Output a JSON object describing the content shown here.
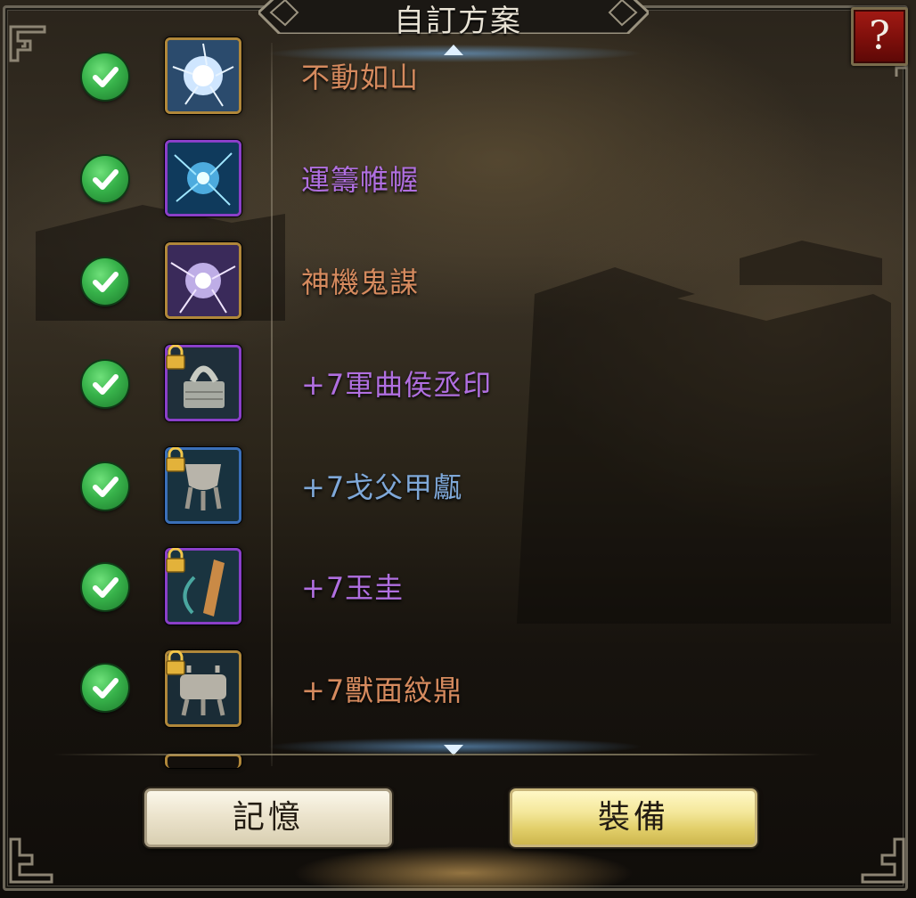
{
  "window": {
    "title": "自訂方案",
    "help_label": "?"
  },
  "list": {
    "items": [
      {
        "name": "不動如山",
        "color": "#d58a5e",
        "checked": true,
        "locked": false,
        "icon": "lightning-orb-icon",
        "frame": "#b0873a"
      },
      {
        "name": "運籌帷幄",
        "color": "#b06fe0",
        "checked": true,
        "locked": false,
        "icon": "blue-burst-icon",
        "frame": "#8a3fc8"
      },
      {
        "name": "神機鬼謀",
        "color": "#d58a5e",
        "checked": true,
        "locked": false,
        "icon": "violet-burst-icon",
        "frame": "#b0873a"
      },
      {
        "name": "+7軍曲侯丞印",
        "color": "#b06fe0",
        "checked": true,
        "locked": true,
        "icon": "seal-icon",
        "frame": "#8a3fc8"
      },
      {
        "name": "+7戈父甲甗",
        "color": "#7fa8d8",
        "checked": true,
        "locked": true,
        "icon": "bronze-vessel-icon",
        "frame": "#3a6fb8"
      },
      {
        "name": "+7玉圭",
        "color": "#b06fe0",
        "checked": true,
        "locked": true,
        "icon": "jade-tablet-icon",
        "frame": "#8a3fc8"
      },
      {
        "name": "+7獸面紋鼎",
        "color": "#d58a5e",
        "checked": true,
        "locked": true,
        "icon": "ding-cauldron-icon",
        "frame": "#b0873a"
      }
    ]
  },
  "buttons": {
    "memory_label": "記憶",
    "equip_label": "裝備"
  }
}
